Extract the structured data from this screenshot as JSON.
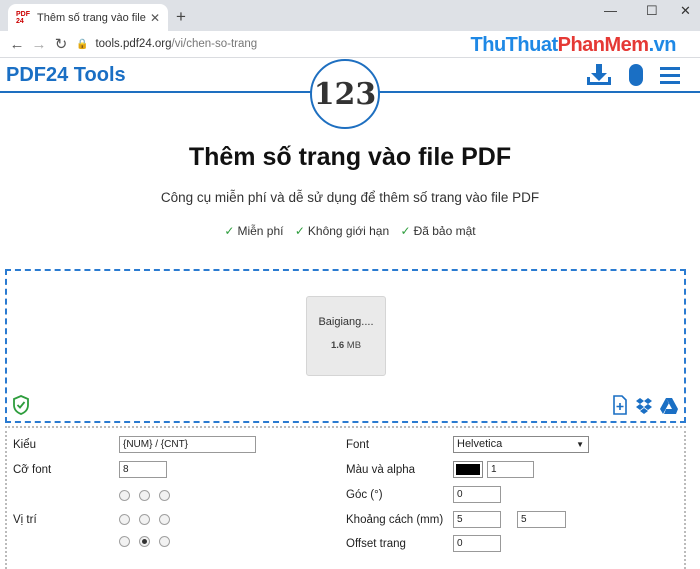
{
  "browser": {
    "tab_title": "Thêm số trang vào file PDF - Miễ",
    "favicon_text": "PDF 24",
    "url_host": "tools.pdf24.org",
    "url_path": "/vi/chen-so-trang"
  },
  "watermark": {
    "part1": "ThuThuat",
    "part2": "PhanMem",
    "part3": ".vn"
  },
  "site": {
    "logo": "PDF24 Tools",
    "mascot_text": "123"
  },
  "hero": {
    "title": "Thêm số trang vào file PDF",
    "subtitle": "Công cụ miễn phí và dễ sử dụng để thêm số trang vào file PDF",
    "features": [
      "Miễn phí",
      "Không giới hạn",
      "Đã bảo mật"
    ]
  },
  "file": {
    "name": "Baigiang....",
    "size_value": "1.6",
    "size_unit": "MB"
  },
  "options": {
    "style_label": "Kiểu",
    "style_value": "{NUM} / {CNT}",
    "font_size_label": "Cỡ font",
    "font_size_value": "8",
    "position_label": "Vị trí",
    "font_label": "Font",
    "font_value": "Helvetica",
    "color_label": "Màu và alpha",
    "color_value": "#000000",
    "alpha_value": "1",
    "angle_label": "Góc (°)",
    "angle_value": "0",
    "margin_label": "Khoảng cách (mm)",
    "margin_x": "5",
    "margin_y": "5",
    "offset_label": "Offset trang",
    "offset_value": "0",
    "selected_position": "bottom-center"
  }
}
